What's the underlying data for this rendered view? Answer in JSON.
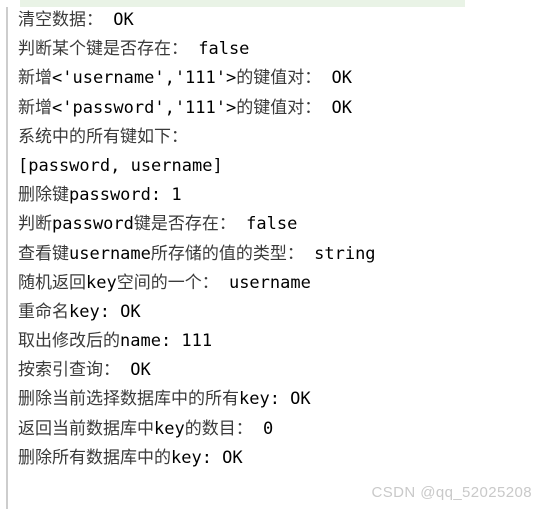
{
  "window": {
    "background_color": "#ffffff",
    "accent_band_color": "#e9f3e6",
    "rule_color": "#cdcdcd",
    "text_color": "#000000",
    "cjk_text_color": "#3a3a3a"
  },
  "console": {
    "lines": [
      {
        "cjk_prefix": "清空数据：",
        "mono_suffix": " OK"
      },
      {
        "cjk_prefix": "判断某个键是否存在：",
        "mono_suffix": " false"
      },
      {
        "cjk_prefix": "新增",
        "mono_mid": "<'username','111'>",
        "cjk_mid": "的键值对：",
        "mono_suffix": " OK"
      },
      {
        "cjk_prefix": "新增",
        "mono_mid": "<'password','111'>",
        "cjk_mid": "的键值对：",
        "mono_suffix": " OK"
      },
      {
        "cjk_prefix": "系统中的所有键如下：",
        "mono_suffix": ""
      },
      {
        "cjk_prefix": "",
        "mono_suffix": "[password, username]"
      },
      {
        "cjk_prefix": "删除键",
        "mono_mid": "password: 1",
        "cjk_mid": "",
        "mono_suffix": ""
      },
      {
        "cjk_prefix": "判断",
        "mono_mid": "password",
        "cjk_mid": "键是否存在：",
        "mono_suffix": " false"
      },
      {
        "cjk_prefix": "查看键",
        "mono_mid": "username",
        "cjk_mid": "所存储的值的类型：",
        "mono_suffix": " string"
      },
      {
        "cjk_prefix": "随机返回",
        "mono_mid": "key",
        "cjk_mid": "空间的一个：",
        "mono_suffix": " username"
      },
      {
        "cjk_prefix": "重命名",
        "mono_mid": "key: OK",
        "cjk_mid": "",
        "mono_suffix": ""
      },
      {
        "cjk_prefix": "取出修改后的",
        "mono_mid": "name: 111",
        "cjk_mid": "",
        "mono_suffix": ""
      },
      {
        "cjk_prefix": "按索引查询：",
        "mono_suffix": " OK"
      },
      {
        "cjk_prefix": "删除当前选择数据库中的所有",
        "mono_mid": "key: OK",
        "cjk_mid": "",
        "mono_suffix": ""
      },
      {
        "cjk_prefix": "返回当前数据库中",
        "mono_mid": "key",
        "cjk_mid": "的数目：",
        "mono_suffix": " 0"
      },
      {
        "cjk_prefix": "删除所有数据库中的",
        "mono_mid": "key: OK",
        "cjk_mid": "",
        "mono_suffix": ""
      }
    ]
  },
  "watermark": {
    "text": "CSDN @qq_52025208"
  }
}
